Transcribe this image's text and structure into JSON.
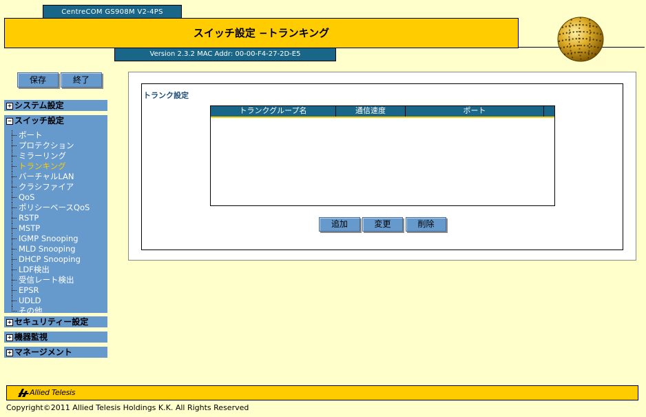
{
  "header": {
    "model": "CentreCOM GS908M V2-4PS",
    "title": "スイッチ設定 −トランキング",
    "version": "Version 2.3.2 MAC Addr: 00-00-F4-27-2D-E5"
  },
  "toolbar": {
    "save_label": "保存",
    "exit_label": "終了"
  },
  "menu": {
    "system": {
      "label": "システム設定",
      "expander": "+"
    },
    "switch": {
      "label": "スイッチ設定",
      "expander": "−",
      "items": [
        "ポート",
        "プロテクション",
        "ミラーリング",
        "トランキング",
        "バーチャルLAN",
        "クラシファイア",
        "QoS",
        "ポリシーベースQoS",
        "RSTP",
        "MSTP",
        "IGMP Snooping",
        "MLD Snooping",
        "DHCP Snooping",
        "LDF検出",
        "受信レート検出",
        "EPSR",
        "UDLD",
        "その他"
      ],
      "active": "トランキング"
    },
    "security": {
      "label": "セキュリティー設定",
      "expander": "+"
    },
    "monitor": {
      "label": "機器監視",
      "expander": "+"
    },
    "management": {
      "label": "マネージメント",
      "expander": "+"
    }
  },
  "content": {
    "section_title": "トランク設定",
    "table": {
      "columns": [
        "トランクグループ名",
        "通信速度",
        "ポート",
        ""
      ],
      "rows": []
    },
    "buttons": {
      "add": "追加",
      "edit": "変更",
      "delete": "削除"
    }
  },
  "footer": {
    "brand": "Allied Telesis",
    "copyright": "Copyright©2011 Allied Telesis Holdings K.K. All Rights Reserved"
  },
  "colors": {
    "page_bg": "#FFFFCC",
    "header_yellow": "#FFCC00",
    "header_teal": "#1A6688",
    "menu_blue": "#6699CC",
    "menu_active": "#FFCC00"
  }
}
